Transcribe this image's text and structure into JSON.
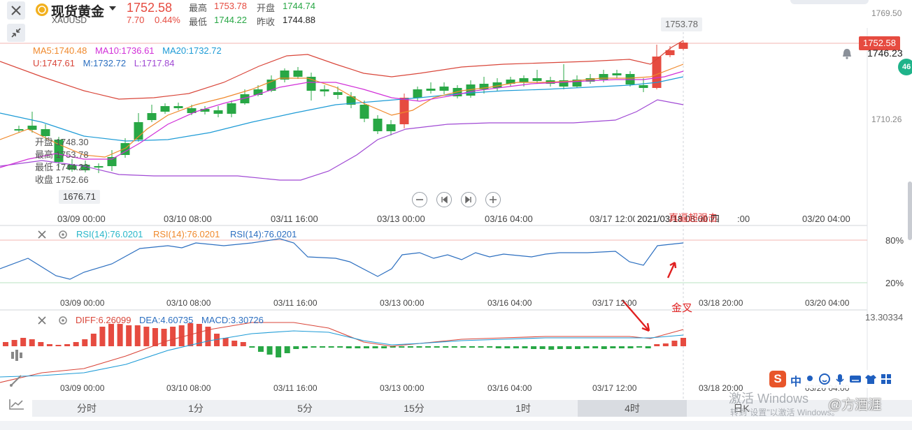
{
  "header": {
    "instrument_name": "现货黄金",
    "symbol": "XAUUSD",
    "price": "1752.58",
    "change": "7.70",
    "change_pct": "0.44%",
    "high_label": "最高",
    "high_value": "1753.78",
    "low_label": "最低",
    "low_value": "1744.22",
    "open_label": "开盘",
    "open_value": "1744.74",
    "prev_label": "昨收",
    "prev_value": "1744.88"
  },
  "main_panel": {
    "ma_line1": [
      {
        "text": "MA5:1740.48",
        "color": "#f0892c"
      },
      {
        "text": "MA10:1736.61",
        "color": "#d12fd8"
      },
      {
        "text": "MA20:1732.72",
        "color": "#1d9bd6"
      }
    ],
    "ma_line2": [
      {
        "text": "U:1747.61",
        "color": "#d9463a"
      },
      {
        "text": "M:1732.72",
        "color": "#2c6fc0"
      },
      {
        "text": "L:1717.84",
        "color": "#a049d4"
      }
    ],
    "tooltip": {
      "open": "开盘 1748.30",
      "high": "最高 1753.78",
      "low": "最低 1744.23",
      "close": "收盘 1752.66"
    },
    "price_axis": {
      "top": "1769.50",
      "mid": "1710.26"
    },
    "high_marker": "1753.78",
    "low_marker": "1676.71",
    "price_tag": "1752.58",
    "alert_price": "1746.23",
    "badge": "46",
    "time_labels": [
      "03/09 00:00",
      "03/10 08:00",
      "03/11 16:00",
      "03/13 00:00",
      "03/16 04:00",
      "03/17 12:00",
      "03/20 04:00"
    ],
    "crosshair_time": "2021/03/18 08:00 四",
    "crosshair_time_tail": ":00",
    "annotation_red": "真逼超强击"
  },
  "rsi_panel": {
    "labels": [
      {
        "text": "RSI(14):76.0201",
        "color": "#28b6c9"
      },
      {
        "text": "RSI(14):76.0201",
        "color": "#f0892c"
      },
      {
        "text": "RSI(14):76.0201",
        "color": "#2c6fc0"
      }
    ],
    "axis_top": "80%",
    "axis_bottom": "20%",
    "time_labels": [
      "03/09 00:00",
      "03/10 08:00",
      "03/11 16:00",
      "03/13 00:00",
      "03/16 04:00",
      "03/17 12:00",
      "03/18 20:00",
      "03/20 04:00"
    ]
  },
  "macd_panel": {
    "labels": [
      {
        "text": "DIFF:6.26099",
        "color": "#d9463a"
      },
      {
        "text": "DEA:4.60735",
        "color": "#2c6fc0"
      },
      {
        "text": "MACD:3.30726",
        "color": "#2c6fc0"
      }
    ],
    "axis_top": "13.30334",
    "annotation": "金叉",
    "time_labels": [
      "03/09 00:00",
      "03/10 08:00",
      "03/11 16:00",
      "03/13 00:00",
      "03/16 04:00",
      "03/17 12:00",
      "03/18 20:00",
      "03/20 04:00"
    ]
  },
  "timeframe_tabs": [
    "分时",
    "1分",
    "5分",
    "15分",
    "1时",
    "4时",
    "日K"
  ],
  "active_tab": "4时",
  "watermark": {
    "line1": "激活 Windows",
    "line2": "转到\"设置\"以激活 Windows。",
    "author": "@方酒涯"
  },
  "ime": {
    "lang": "中"
  },
  "colors": {
    "up": "#e64b40",
    "down": "#28a745",
    "ma5": "#f0892c",
    "ma10": "#d12fd8",
    "ma20": "#1d9bd6",
    "boll_u": "#d9463a",
    "boll_l": "#a049d4"
  }
}
